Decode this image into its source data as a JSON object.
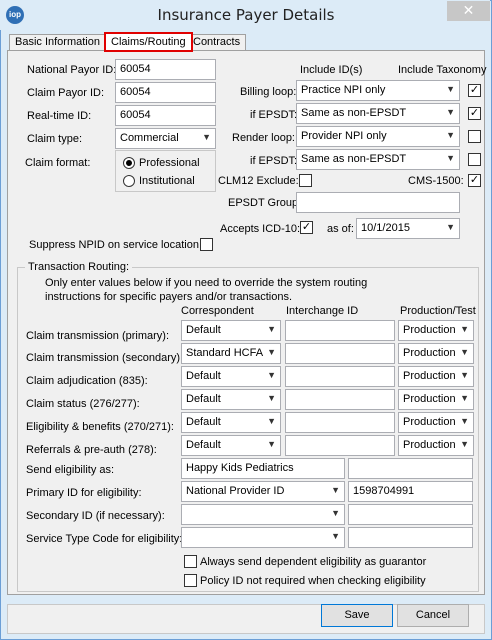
{
  "window": {
    "title": "Insurance Payer Details",
    "close": "✕",
    "icon": "iop"
  },
  "tabs": [
    {
      "label": "Basic Information"
    },
    {
      "label": "Claims/Routing"
    },
    {
      "label": "Contracts"
    }
  ],
  "left": {
    "national_payor_id": {
      "label": "National Payor ID:",
      "value": "60054"
    },
    "claim_payor_id": {
      "label": "Claim Payor ID:",
      "value": "60054"
    },
    "realtime_id": {
      "label": "Real-time ID:",
      "value": "60054"
    },
    "claim_type": {
      "label": "Claim type:",
      "value": "Commercial"
    },
    "claim_format": {
      "label": "Claim format:",
      "options": [
        "Professional",
        "Institutional"
      ],
      "selected": "Professional"
    },
    "suppress_npid": {
      "label": "Suppress NPID on service location",
      "checked": false
    }
  },
  "right": {
    "header_include_ids": "Include ID(s)",
    "header_include_taxonomy": "Include Taxonomy",
    "billing_loop": {
      "label": "Billing loop:",
      "value": "Practice NPI only",
      "taxonomy": true
    },
    "billing_if_epsdt": {
      "label": "if EPSDT:",
      "value": "Same as non-EPSDT",
      "taxonomy": true
    },
    "render_loop": {
      "label": "Render loop:",
      "value": "Provider NPI only",
      "taxonomy": false
    },
    "render_if_epsdt": {
      "label": "if EPSDT:",
      "value": "Same as non-EPSDT",
      "taxonomy": false
    },
    "clm12_exclude": {
      "label": "CLM12 Exclude:",
      "checked": false
    },
    "cms1500": {
      "label": "CMS-1500:",
      "checked": true
    },
    "epsdt_group": {
      "label": "EPSDT Group:",
      "value": ""
    },
    "accepts_icd10": {
      "label": "Accepts ICD-10:",
      "checked": true
    },
    "as_of": {
      "label": "as of:",
      "value": "10/1/2015"
    }
  },
  "routing": {
    "legend": "Transaction Routing:",
    "instructions_1": "Only enter values below if you need to override the system routing",
    "instructions_2": "instructions for specific payers and/or transactions.",
    "col_correspondent": "Correspondent",
    "col_interchange": "Interchange ID",
    "col_production": "Production/Test",
    "rows": [
      {
        "label": "Claim transmission (primary):",
        "correspondent": "Default",
        "interchange": "",
        "mode": "Production"
      },
      {
        "label": "Claim transmission (secondary):",
        "correspondent": "Standard HCFA",
        "interchange": "",
        "mode": "Production"
      },
      {
        "label": "Claim adjudication (835):",
        "correspondent": "Default",
        "interchange": "",
        "mode": "Production"
      },
      {
        "label": "Claim status (276/277):",
        "correspondent": "Default",
        "interchange": "",
        "mode": "Production"
      },
      {
        "label": "Eligibility & benefits (270/271):",
        "correspondent": "Default",
        "interchange": "",
        "mode": "Production"
      },
      {
        "label": "Referrals & pre-auth (278):",
        "correspondent": "Default",
        "interchange": "",
        "mode": "Production"
      }
    ],
    "send_eligibility_as": {
      "label": "Send eligibility as:",
      "value": "Happy Kids Pediatrics",
      "extra": ""
    },
    "primary_id": {
      "label": "Primary ID for eligibility:",
      "type": "National Provider ID",
      "value": "1598704991"
    },
    "secondary_id": {
      "label": "Secondary ID (if necessary):",
      "type": "",
      "value": ""
    },
    "service_type": {
      "label": "Service Type Code for eligibility:",
      "type": "",
      "value": ""
    },
    "always_dependent": {
      "label": "Always send dependent eligibility as guarantor",
      "checked": false
    },
    "policy_id_not_required": {
      "label": "Policy ID not required when checking eligibility",
      "checked": false
    }
  },
  "buttons": {
    "save": "Save",
    "cancel": "Cancel"
  }
}
